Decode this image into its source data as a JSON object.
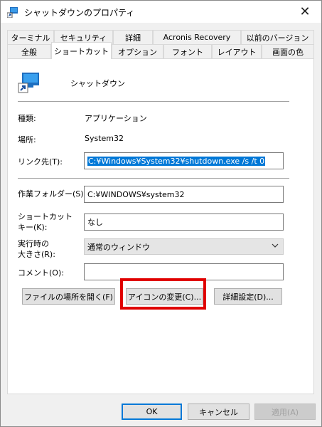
{
  "window": {
    "title": "シャットダウンのプロパティ",
    "close_label": "✕"
  },
  "tabs_row1": [
    "ターミナル",
    "セキュリティ",
    "詳細",
    "Acronis Recovery",
    "以前のバージョン"
  ],
  "tabs_row2": [
    "全般",
    "ショートカット",
    "オプション",
    "フォント",
    "レイアウト",
    "画面の色"
  ],
  "shortcut": {
    "name": "シャットダウン",
    "type_label": "種類:",
    "type_value": "アプリケーション",
    "location_label": "場所:",
    "location_value": "System32",
    "target_label": "リンク先(T):",
    "target_value": "C:¥Windows¥System32¥shutdown.exe /s /t 0",
    "start_in_label": "作業フォルダー(S):",
    "start_in_value": "C:¥WINDOWS¥system32",
    "hotkey_label_line1": "ショートカット",
    "hotkey_label_line2": "キー(K):",
    "hotkey_value": "なし",
    "run_label_line1": "実行時の",
    "run_label_line2": "大きさ(R):",
    "run_value": "通常のウィンドウ",
    "comment_label": "コメント(O):",
    "comment_value": ""
  },
  "buttons": {
    "open_location": "ファイルの場所を開く(F)",
    "change_icon": "アイコンの変更(C)...",
    "advanced": "詳細設定(D)...",
    "ok": "OK",
    "cancel": "キャンセル",
    "apply": "適用(A)"
  },
  "colors": {
    "highlight": "#e00000",
    "selection": "#0078d7"
  }
}
